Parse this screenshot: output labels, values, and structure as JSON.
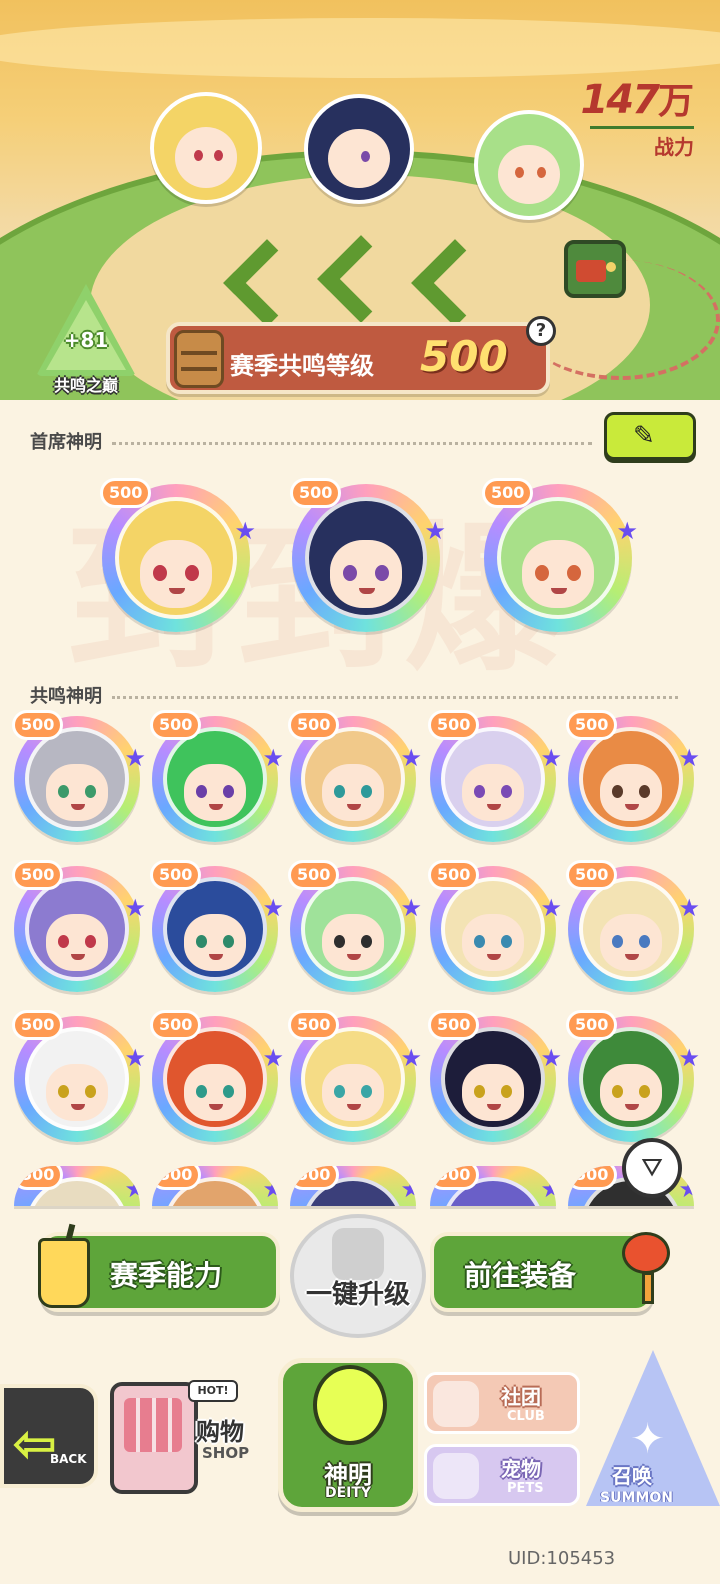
{
  "power": {
    "value": "147",
    "unit": "万",
    "label": "战力"
  },
  "resonance_peak": {
    "bonus": "+81",
    "label": "共鸣之巅"
  },
  "season": {
    "label": "赛季共鸣等级",
    "level": "500",
    "help_icon": "question-icon"
  },
  "chief_section": {
    "title": "首席神明",
    "edit_icon": "pencil-icon"
  },
  "resonant_section": {
    "title": "共鸣神明"
  },
  "watermark": "到到爆",
  "chief_deities": [
    {
      "level": "500",
      "hair": "#f4d466",
      "eye": "#c0394a"
    },
    {
      "level": "500",
      "hair": "#27305e",
      "eye": "#7a4aa8"
    },
    {
      "level": "500",
      "hair": "#a8e089",
      "eye": "#d5663d"
    }
  ],
  "resonant_deities": [
    {
      "level": "500",
      "hair": "#b7b7c2",
      "eye": "#3c9a6a"
    },
    {
      "level": "500",
      "hair": "#3fc35c",
      "eye": "#6a3fa8"
    },
    {
      "level": "500",
      "hair": "#f1c98a",
      "eye": "#2e9a9a"
    },
    {
      "level": "500",
      "hair": "#d9d0ee",
      "eye": "#7a4ab5"
    },
    {
      "level": "500",
      "hair": "#e98b45",
      "eye": "#5a3a2a"
    },
    {
      "level": "500",
      "hair": "#8c7bd0",
      "eye": "#c0394a"
    },
    {
      "level": "500",
      "hair": "#2b4c9c",
      "eye": "#2e8a6a"
    },
    {
      "level": "500",
      "hair": "#9fe29a",
      "eye": "#2e2e2e"
    },
    {
      "level": "500",
      "hair": "#f3e3b4",
      "eye": "#3a8ab0"
    },
    {
      "level": "500",
      "hair": "#f3e3b4",
      "eye": "#4a7ac0"
    },
    {
      "level": "500",
      "hair": "#f2f2f2",
      "eye": "#c9a21d"
    },
    {
      "level": "500",
      "hair": "#e0562e",
      "eye": "#2e9a8a"
    },
    {
      "level": "500",
      "hair": "#f5dc86",
      "eye": "#3aa6a6"
    },
    {
      "level": "500",
      "hair": "#1d1d3a",
      "eye": "#c9a21d"
    },
    {
      "level": "500",
      "hair": "#3e8a3a",
      "eye": "#c9a21d"
    },
    {
      "level": "500",
      "hair": "#e8dcc0",
      "eye": "#5a5a5a"
    },
    {
      "level": "500",
      "hair": "#e2a46c",
      "eye": "#5a5a5a"
    },
    {
      "level": "500",
      "hair": "#3b3f7a",
      "eye": "#5a5a5a"
    },
    {
      "level": "500",
      "hair": "#6a5fc8",
      "eye": "#5a5a5a"
    },
    {
      "level": "500",
      "hair": "#2f2f2f",
      "eye": "#5a5a5a"
    }
  ],
  "actions": {
    "season_ability": "赛季能力",
    "one_click_upgrade": "一键升级",
    "go_equip": "前往装备"
  },
  "nav": {
    "back": "BACK",
    "shop_hot": "HOT!",
    "shop_cn": "购物",
    "shop_en": "SHOP",
    "deity_cn": "神明",
    "deity_en": "DEITY",
    "club_cn": "社团",
    "club_en": "CLUB",
    "pets_cn": "宠物",
    "pets_en": "PETS",
    "summon_cn": "召唤",
    "summon_en": "SUMMON"
  },
  "uid": "UID:105453"
}
